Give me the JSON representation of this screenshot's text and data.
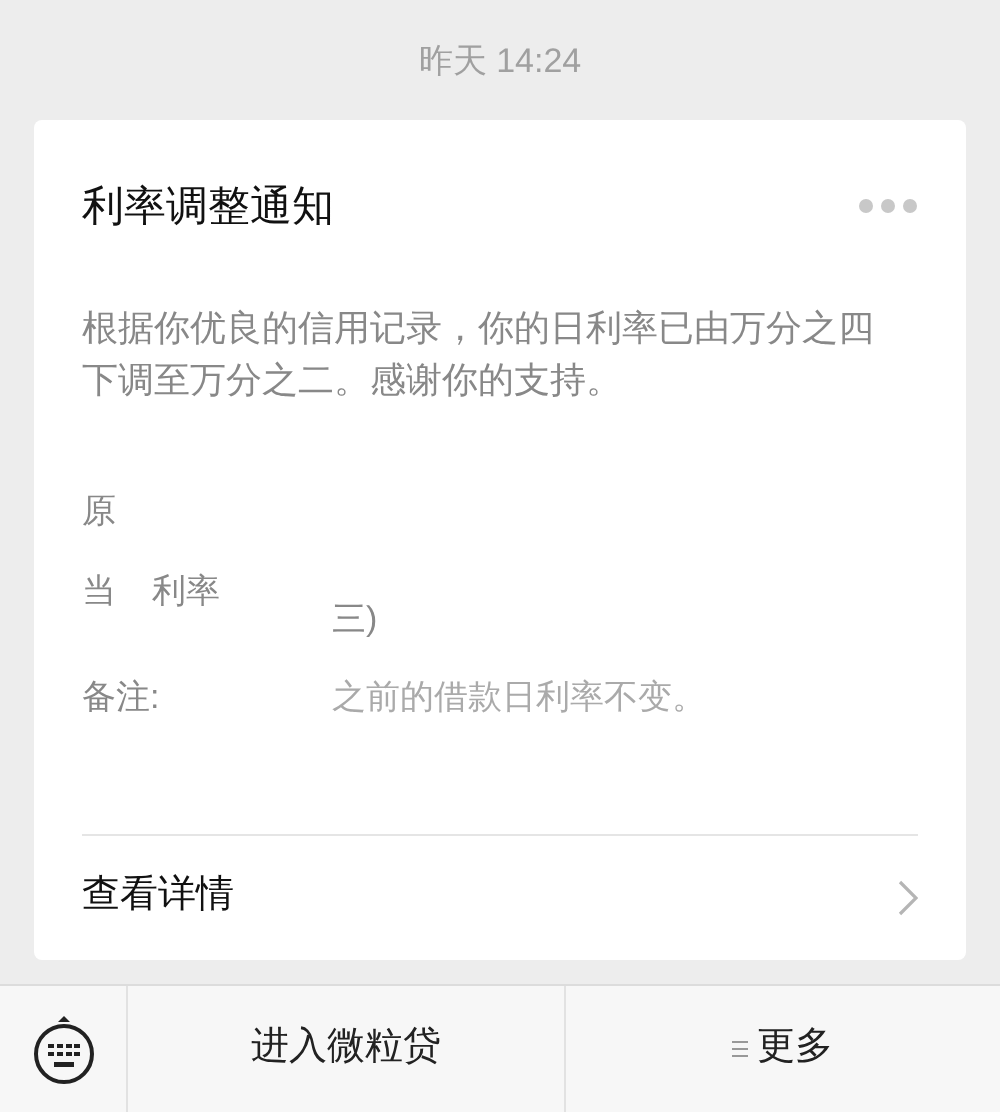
{
  "time": "昨天 14:24",
  "card": {
    "title": "利率调整通知",
    "body": "根据你优良的信用记录，你的日利率已由万分之四下调至万分之二。感谢你的支持。",
    "rows": [
      {
        "label_parts": [
          "原"
        ]
      },
      {
        "label_parts": [
          "当",
          "利率"
        ],
        "value_tail": "三)"
      },
      {
        "label_parts": [
          "备注:"
        ],
        "value": "之前的借款日利率不变。"
      }
    ],
    "link": "查看详情"
  },
  "bottom_bar": {
    "items": [
      {
        "kind": "keyboard"
      },
      {
        "kind": "text",
        "label": "进入微粒贷"
      },
      {
        "kind": "menu",
        "label": "更多"
      }
    ]
  }
}
